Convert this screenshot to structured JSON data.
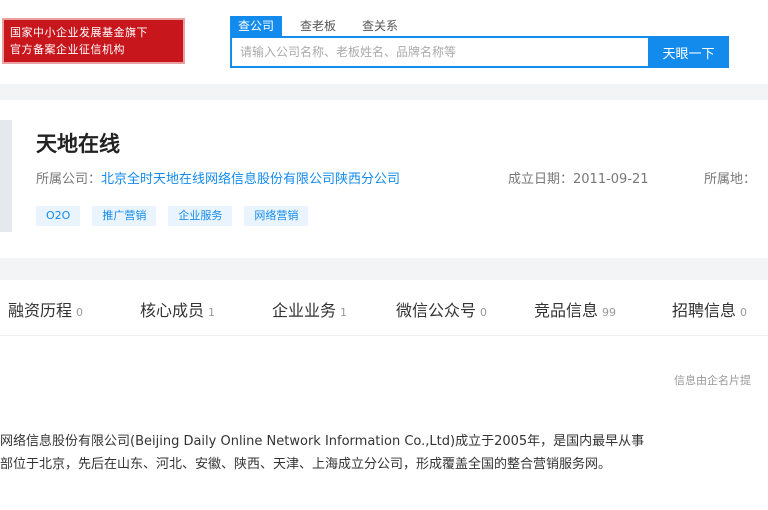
{
  "header": {
    "badge_line1": "国家中小企业发展基金旗下",
    "badge_line2": "官方备案企业征信机构",
    "search_tabs": [
      {
        "label": "查公司",
        "active": true
      },
      {
        "label": "查老板",
        "active": false
      },
      {
        "label": "查关系",
        "active": false
      }
    ],
    "search_placeholder": "请输入公司名称、老板姓名、品牌名称等",
    "search_button": "天眼一下"
  },
  "company": {
    "name": "天地在线",
    "parent_label": "所属公司：",
    "parent_value": "北京全时天地在线网络信息股份有限公司陕西分公司",
    "founded_label": "成立日期：",
    "founded_value": "2011-09-21",
    "location_label": "所属地：",
    "tags": [
      "O2O",
      "推广营销",
      "企业服务",
      "网络营销"
    ]
  },
  "tabs": [
    {
      "label": "融资历程",
      "count": "0"
    },
    {
      "label": "核心成员",
      "count": "1"
    },
    {
      "label": "企业业务",
      "count": "1"
    },
    {
      "label": "微信公众号",
      "count": "0"
    },
    {
      "label": "竞品信息",
      "count": "99"
    },
    {
      "label": "招聘信息",
      "count": "0"
    }
  ],
  "source_note": "信息由企名片提",
  "description": {
    "line1": "网络信息股份有限公司(Beijing Daily Online Network Information Co.,Ltd)成立于2005年，是国内最早从事",
    "line2": "部位于北京，先后在山东、河北、安徽、陕西、天津、上海成立分公司，形成覆盖全国的整合营销服务网。"
  },
  "colors": {
    "accent": "#128bed",
    "badge_red": "#c8161d",
    "tag_bg": "#eaf4fe"
  }
}
